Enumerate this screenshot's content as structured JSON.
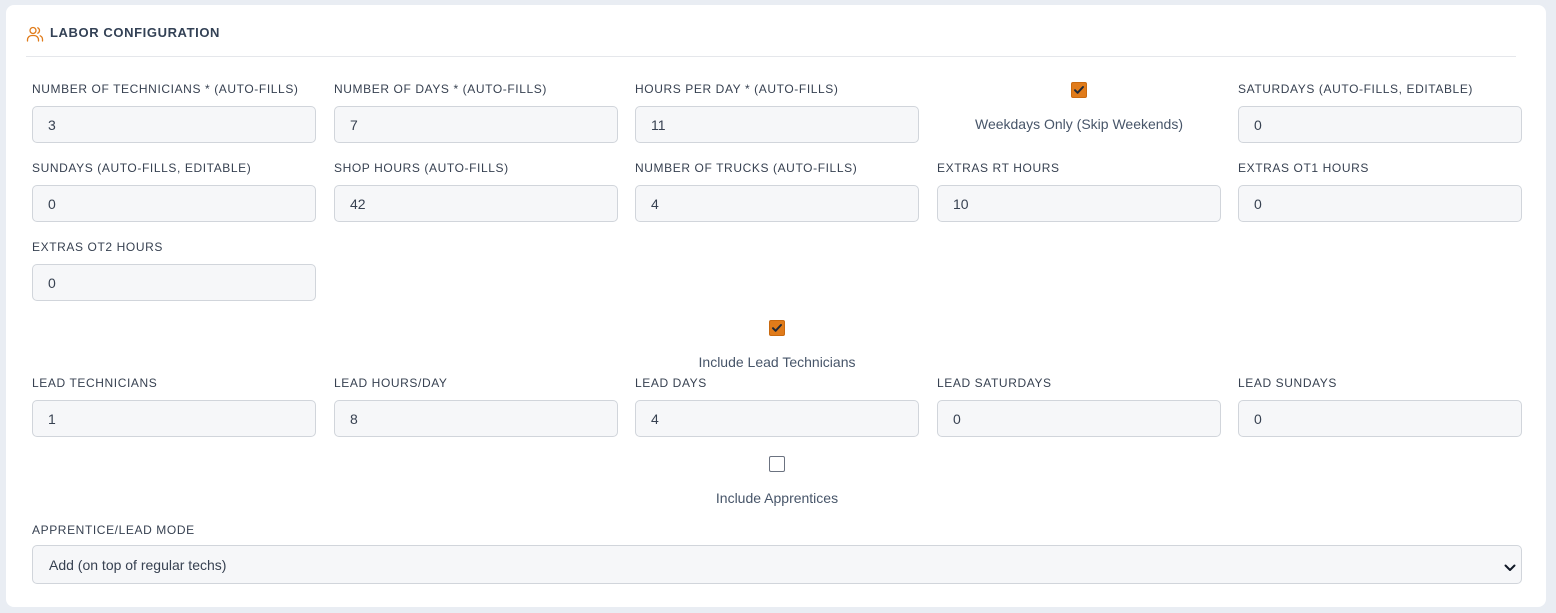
{
  "section": {
    "title": "LABOR CONFIGURATION",
    "icon": "users-icon",
    "accent_color": "#e07b1a"
  },
  "fields": {
    "technicians": {
      "label": "NUMBER OF TECHNICIANS * (AUTO-FILLS)",
      "value": "3"
    },
    "days": {
      "label": "NUMBER OF DAYS * (AUTO-FILLS)",
      "value": "7"
    },
    "hours_per_day": {
      "label": "HOURS PER DAY * (AUTO-FILLS)",
      "value": "11"
    },
    "saturdays": {
      "label": "SATURDAYS (AUTO-FILLS, EDITABLE)",
      "value": "0"
    },
    "sundays": {
      "label": "SUNDAYS (AUTO-FILLS, EDITABLE)",
      "value": "0"
    },
    "shop_hours": {
      "label": "SHOP HOURS (AUTO-FILLS)",
      "value": "42"
    },
    "trucks": {
      "label": "NUMBER OF TRUCKS (AUTO-FILLS)",
      "value": "4"
    },
    "extras_rt": {
      "label": "EXTRAS RT HOURS",
      "value": "10"
    },
    "extras_ot1": {
      "label": "EXTRAS OT1 HOURS",
      "value": "0"
    },
    "extras_ot2": {
      "label": "EXTRAS OT2 HOURS",
      "value": "0"
    },
    "lead_technicians": {
      "label": "LEAD TECHNICIANS",
      "value": "1"
    },
    "lead_hours_day": {
      "label": "LEAD HOURS/DAY",
      "value": "8"
    },
    "lead_days": {
      "label": "LEAD DAYS",
      "value": "4"
    },
    "lead_saturdays": {
      "label": "LEAD SATURDAYS",
      "value": "0"
    },
    "lead_sundays": {
      "label": "LEAD SUNDAYS",
      "value": "0"
    }
  },
  "checkboxes": {
    "weekdays_only": {
      "label": "Weekdays Only (Skip Weekends)",
      "checked": true
    },
    "include_lead": {
      "label": "Include Lead Technicians",
      "checked": true
    },
    "include_apprentices": {
      "label": "Include Apprentices",
      "checked": false
    }
  },
  "mode": {
    "label": "APPRENTICE/LEAD MODE",
    "selected": "Add (on top of regular techs)"
  }
}
